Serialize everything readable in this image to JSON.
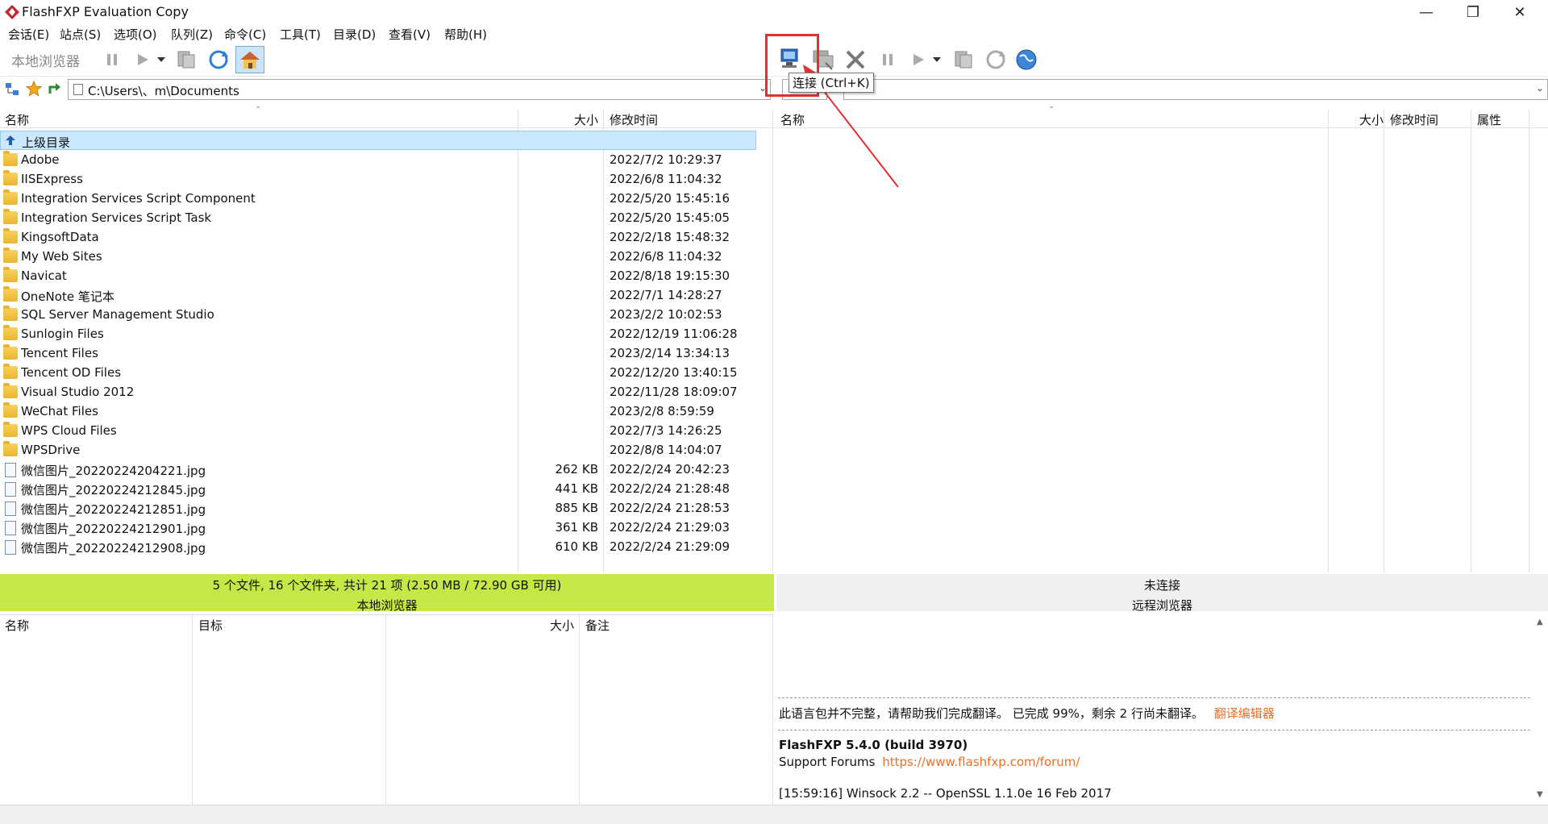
{
  "window": {
    "title": "FlashFXP Evaluation Copy",
    "minimize": "—",
    "restore": "❐",
    "close": "✕"
  },
  "menu": [
    "会话(E)",
    "站点(S)",
    "选项(O)",
    "队列(Z)",
    "命令(C)",
    "工具(T)",
    "目录(D)",
    "查看(V)",
    "帮助(H)"
  ],
  "toolbar": {
    "local_label": "本地浏览器",
    "tooltip": "连接 (Ctrl+K)"
  },
  "local": {
    "path": "C:\\Users\\、m\\Documents",
    "columns": {
      "name": "名称",
      "size": "大小",
      "modified": "修改时间"
    },
    "parent_dir": "上级目录",
    "rows": [
      {
        "type": "folder",
        "name": "Adobe",
        "size": "",
        "date": "2022/7/2 10:29:37"
      },
      {
        "type": "folder",
        "name": "IISExpress",
        "size": "",
        "date": "2022/6/8 11:04:32"
      },
      {
        "type": "folder",
        "name": "Integration Services Script Component",
        "size": "",
        "date": "2022/5/20 15:45:16"
      },
      {
        "type": "folder",
        "name": "Integration Services Script Task",
        "size": "",
        "date": "2022/5/20 15:45:05"
      },
      {
        "type": "folder",
        "name": "KingsoftData",
        "size": "",
        "date": "2022/2/18 15:48:32"
      },
      {
        "type": "folder",
        "name": "My Web Sites",
        "size": "",
        "date": "2022/6/8 11:04:32"
      },
      {
        "type": "folder",
        "name": "Navicat",
        "size": "",
        "date": "2022/8/18 19:15:30"
      },
      {
        "type": "folder",
        "name": "OneNote 笔记本",
        "size": "",
        "date": "2022/7/1 14:28:27"
      },
      {
        "type": "folder",
        "name": "SQL Server Management Studio",
        "size": "",
        "date": "2023/2/2 10:02:53"
      },
      {
        "type": "folder",
        "name": "Sunlogin Files",
        "size": "",
        "date": "2022/12/19 11:06:28"
      },
      {
        "type": "folder",
        "name": "Tencent Files",
        "size": "",
        "date": "2023/2/14 13:34:13"
      },
      {
        "type": "folder",
        "name": "Tencent OD Files",
        "size": "",
        "date": "2022/12/20 13:40:15"
      },
      {
        "type": "folder",
        "name": "Visual Studio 2012",
        "size": "",
        "date": "2022/11/28 18:09:07"
      },
      {
        "type": "folder",
        "name": "WeChat Files",
        "size": "",
        "date": "2023/2/8 8:59:59"
      },
      {
        "type": "folder",
        "name": "WPS Cloud Files",
        "size": "",
        "date": "2022/7/3 14:26:25"
      },
      {
        "type": "folder",
        "name": "WPSDrive",
        "size": "",
        "date": "2022/8/8 14:04:07"
      },
      {
        "type": "file",
        "name": "微信图片_20220224204221.jpg",
        "size": "262 KB",
        "date": "2022/2/24 20:42:23"
      },
      {
        "type": "file",
        "name": "微信图片_20220224212845.jpg",
        "size": "441 KB",
        "date": "2022/2/24 21:28:48"
      },
      {
        "type": "file",
        "name": "微信图片_20220224212851.jpg",
        "size": "885 KB",
        "date": "2022/2/24 21:28:53"
      },
      {
        "type": "file",
        "name": "微信图片_20220224212901.jpg",
        "size": "361 KB",
        "date": "2022/2/24 21:29:03"
      },
      {
        "type": "file",
        "name": "微信图片_20220224212908.jpg",
        "size": "610 KB",
        "date": "2022/2/24 21:29:09"
      }
    ],
    "status": "5 个文件, 16 个文件夹, 共计 21 项 (2.50 MB / 72.90 GB 可用)",
    "pane_label": "本地浏览器"
  },
  "remote": {
    "columns": {
      "name": "名称",
      "size": "大小",
      "modified": "修改时间",
      "attributes": "属性"
    },
    "status": "未连接",
    "pane_label": "远程浏览器"
  },
  "queue": {
    "columns": {
      "name": "名称",
      "target": "目标",
      "size": "大小",
      "note": "备注"
    }
  },
  "log": {
    "translation_note": "此语言包并不完整，请帮助我们完成翻译。 已完成 99%，剩余 2 行尚未翻译。",
    "translation_link": "翻译编辑器",
    "version": "FlashFXP 5.4.0 (build 3970)",
    "forums_label": "Support Forums",
    "forums_url": "https://www.flashfxp.com/forum/",
    "winsock": "[15:59:16] Winsock 2.2 -- OpenSSL 1.1.0e  16 Feb 2017"
  },
  "colors": {
    "local_status_bg": "#c5e846",
    "link": "#e8702a",
    "highlight": "#e03030",
    "selected_row": "#cce8ff"
  }
}
